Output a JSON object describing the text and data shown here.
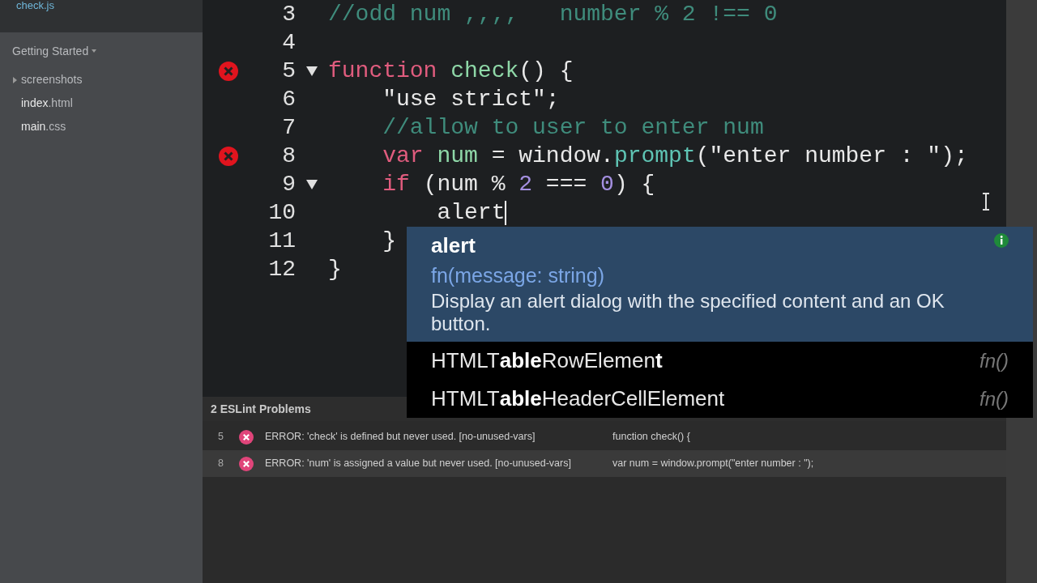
{
  "sidebar": {
    "open_file": "check.js",
    "project": "Getting Started",
    "tree": [
      {
        "label": "screenshots",
        "kind": "folder",
        "expanded": false
      },
      {
        "label": "**index**.html",
        "kind": "file"
      },
      {
        "label": "**main**.css",
        "kind": "file"
      }
    ]
  },
  "editor": {
    "lines": [
      {
        "number": "3",
        "error": false,
        "fold": false,
        "tokens": [
          {
            "kind": "comment",
            "text": "//odd num ,,,,   number % 2 !== 0"
          }
        ]
      },
      {
        "number": "4",
        "error": false,
        "fold": false
      },
      {
        "number": "5",
        "error": true,
        "fold": true,
        "tokens": [
          {
            "kind": "keyword",
            "text": "function "
          },
          {
            "kind": "def",
            "text": "check"
          },
          {
            "kind": "plain",
            "text": "() {"
          }
        ]
      },
      {
        "number": "6",
        "error": false,
        "fold": false,
        "tokens": [
          {
            "kind": "plain",
            "text": "    \"use strict\";"
          }
        ]
      },
      {
        "number": "7",
        "error": false,
        "fold": false,
        "tokens": [
          {
            "kind": "comment",
            "text": "    //allow to user to enter num"
          }
        ]
      },
      {
        "number": "8",
        "error": true,
        "fold": false,
        "tokens": [
          {
            "kind": "keyword",
            "text": "    var "
          },
          {
            "kind": "def",
            "text": "num"
          },
          {
            "kind": "plain",
            "text": " = window."
          },
          {
            "kind": "prop",
            "text": "prompt"
          },
          {
            "kind": "plain",
            "text": "(\"enter number : \");"
          }
        ]
      },
      {
        "number": "9",
        "error": false,
        "fold": true,
        "tokens": [
          {
            "kind": "keyword",
            "text": "    if"
          },
          {
            "kind": "plain",
            "text": " (num % "
          },
          {
            "kind": "number",
            "text": "2"
          },
          {
            "kind": "plain",
            "text": " === "
          },
          {
            "kind": "number",
            "text": "0"
          },
          {
            "kind": "plain",
            "text": ") {"
          }
        ]
      },
      {
        "number": "10",
        "error": false,
        "fold": false,
        "cursor": true,
        "tokens": [
          {
            "kind": "plain",
            "text": "        alert"
          }
        ]
      },
      {
        "number": "11",
        "error": false,
        "fold": false,
        "tokens": [
          {
            "kind": "plain",
            "text": "    }"
          }
        ]
      },
      {
        "number": "12",
        "error": false,
        "fold": false,
        "tokens": [
          {
            "kind": "plain",
            "text": "}"
          }
        ]
      }
    ]
  },
  "autocomplete": {
    "items": [
      {
        "name": "alert",
        "selected": true,
        "signature": "fn(message: string)",
        "description": "Display an alert dialog with the specified content and an OK button."
      },
      {
        "name": "HTMLT**able**RowElemen**t**",
        "selected": false,
        "type": "fn()"
      },
      {
        "name": "HTMLT**able**HeaderCellElement",
        "selected": false,
        "type": "fn()"
      }
    ]
  },
  "problems": {
    "title": "2 ESLint Problems",
    "rows": [
      {
        "line": "5",
        "message": "ERROR: 'check' is defined but never used. [no-unused-vars]",
        "code": "function check() {",
        "selected": false
      },
      {
        "line": "8",
        "message": "ERROR: 'num' is assigned a value but never used. [no-unused-vars]",
        "code": "var num = window.prompt(\"enter number : \");",
        "selected": true
      }
    ]
  }
}
